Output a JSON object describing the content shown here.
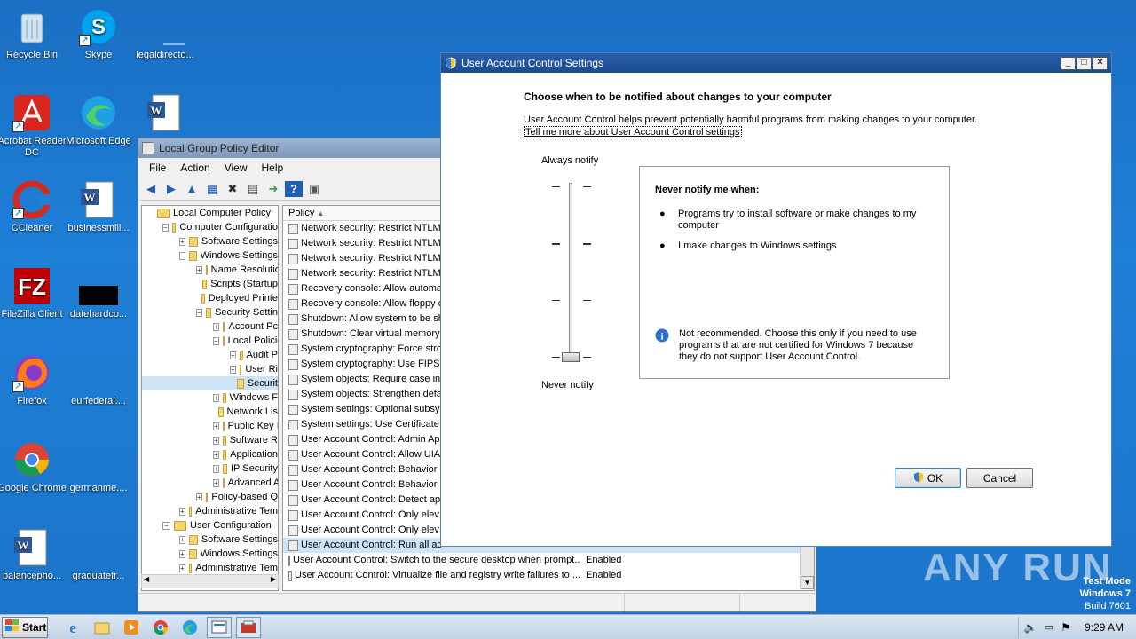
{
  "desktop": {
    "icons": [
      {
        "label": "Recycle Bin",
        "icon": "recycle-bin-icon"
      },
      {
        "label": "Skype",
        "icon": "skype-icon"
      },
      {
        "label": "legaldirecto...",
        "icon": "file-icon"
      },
      {
        "label": "Acrobat Reader DC",
        "icon": "acrobat-icon"
      },
      {
        "label": "Microsoft Edge",
        "icon": "edge-icon"
      },
      {
        "label": "",
        "icon": "word-doc-icon"
      },
      {
        "label": "CCleaner",
        "icon": "ccleaner-icon"
      },
      {
        "label": "businessmili...",
        "icon": "word-doc-icon"
      },
      {
        "label": "FileZilla Client",
        "icon": "filezilla-icon"
      },
      {
        "label": "datehardco...",
        "icon": "black-file-icon"
      },
      {
        "label": "Firefox",
        "icon": "firefox-icon"
      },
      {
        "label": "eurfederal....",
        "icon": "file-icon"
      },
      {
        "label": "Google Chrome",
        "icon": "chrome-icon"
      },
      {
        "label": "germanme....",
        "icon": "file-icon"
      },
      {
        "label": "balancepho...",
        "icon": "word-doc-icon"
      },
      {
        "label": "graduatefr...",
        "icon": "file-icon"
      }
    ],
    "watermark": "ANY RUN",
    "test_mode": [
      "Test Mode",
      "Windows 7",
      "Build 7601"
    ]
  },
  "gpe": {
    "title": "Local Group Policy Editor",
    "menu": [
      "File",
      "Action",
      "View",
      "Help"
    ],
    "tree": [
      {
        "label": "Local Computer Policy",
        "indent": 0,
        "exp": ""
      },
      {
        "label": "Computer Configuratio",
        "indent": 1,
        "exp": "-"
      },
      {
        "label": "Software Settings",
        "indent": 2,
        "exp": "+"
      },
      {
        "label": "Windows Settings",
        "indent": 2,
        "exp": "-"
      },
      {
        "label": "Name Resolutio",
        "indent": 3,
        "exp": "+"
      },
      {
        "label": "Scripts (Startup",
        "indent": 3,
        "exp": ""
      },
      {
        "label": "Deployed Printe",
        "indent": 3,
        "exp": ""
      },
      {
        "label": "Security Settin",
        "indent": 3,
        "exp": "-"
      },
      {
        "label": "Account Pc",
        "indent": 4,
        "exp": "+"
      },
      {
        "label": "Local Policie",
        "indent": 4,
        "exp": "-"
      },
      {
        "label": "Audit P",
        "indent": 5,
        "exp": "+"
      },
      {
        "label": "User Ri",
        "indent": 5,
        "exp": "+"
      },
      {
        "label": "Securit",
        "indent": 5,
        "exp": ""
      },
      {
        "label": "Windows F",
        "indent": 4,
        "exp": "+"
      },
      {
        "label": "Network Lis",
        "indent": 4,
        "exp": ""
      },
      {
        "label": "Public Key I",
        "indent": 4,
        "exp": "+"
      },
      {
        "label": "Software R",
        "indent": 4,
        "exp": "+"
      },
      {
        "label": "Application",
        "indent": 4,
        "exp": "+"
      },
      {
        "label": "IP Security",
        "indent": 4,
        "exp": "+"
      },
      {
        "label": "Advanced A",
        "indent": 4,
        "exp": "+"
      },
      {
        "label": "Policy-based Q",
        "indent": 3,
        "exp": "+"
      },
      {
        "label": "Administrative Tem",
        "indent": 2,
        "exp": "+"
      },
      {
        "label": "User Configuration",
        "indent": 1,
        "exp": "-"
      },
      {
        "label": "Software Settings",
        "indent": 2,
        "exp": "+"
      },
      {
        "label": "Windows Settings",
        "indent": 2,
        "exp": "+"
      },
      {
        "label": "Administrative Tem",
        "indent": 2,
        "exp": "+"
      }
    ],
    "list_header": "Policy",
    "policies": [
      {
        "name": "Network security: Restrict NTLM",
        "setting": ""
      },
      {
        "name": "Network security: Restrict NTLM",
        "setting": ""
      },
      {
        "name": "Network security: Restrict NTLM",
        "setting": ""
      },
      {
        "name": "Network security: Restrict NTLM",
        "setting": ""
      },
      {
        "name": "Recovery console: Allow automa",
        "setting": ""
      },
      {
        "name": "Recovery console: Allow floppy c",
        "setting": ""
      },
      {
        "name": "Shutdown: Allow system to be sh",
        "setting": ""
      },
      {
        "name": "Shutdown: Clear virtual memory",
        "setting": ""
      },
      {
        "name": "System cryptography: Force stro",
        "setting": ""
      },
      {
        "name": "System cryptography: Use FIPS",
        "setting": ""
      },
      {
        "name": "System objects: Require case ins",
        "setting": ""
      },
      {
        "name": "System objects: Strengthen defa",
        "setting": ""
      },
      {
        "name": "System settings: Optional subsy",
        "setting": ""
      },
      {
        "name": "System settings: Use Certificate",
        "setting": ""
      },
      {
        "name": "User Account Control: Admin Ap",
        "setting": ""
      },
      {
        "name": "User Account Control: Allow UIA",
        "setting": ""
      },
      {
        "name": "User Account Control: Behavior",
        "setting": ""
      },
      {
        "name": "User Account Control: Behavior",
        "setting": ""
      },
      {
        "name": "User Account Control: Detect ap",
        "setting": ""
      },
      {
        "name": "User Account Control: Only elev",
        "setting": ""
      },
      {
        "name": "User Account Control: Only elev",
        "setting": ""
      },
      {
        "name": "User Account Control: Run all ac",
        "setting": ""
      },
      {
        "name": "User Account Control: Switch to the secure desktop when prompt...",
        "setting": "Enabled"
      },
      {
        "name": "User Account Control: Virtualize file and registry write failures to ...",
        "setting": "Enabled"
      }
    ]
  },
  "uac": {
    "title": "User Account Control Settings",
    "heading": "Choose when to be notified about changes to your computer",
    "description": "User Account Control helps prevent potentially harmful programs from making changes to your computer.",
    "link": "Tell me more about User Account Control settings",
    "slider_top": "Always notify",
    "slider_bottom": "Never notify",
    "slider_level": 0,
    "info_title": "Never notify me when:",
    "bullets": [
      "Programs try to install software or make changes to my computer",
      "I make changes to Windows settings"
    ],
    "note": "Not recommended. Choose this only if you need to use programs that are not certified for Windows 7 because they do not support User Account Control.",
    "ok": "OK",
    "cancel": "Cancel"
  },
  "taskbar": {
    "start": "Start",
    "time": "9:29 AM"
  }
}
